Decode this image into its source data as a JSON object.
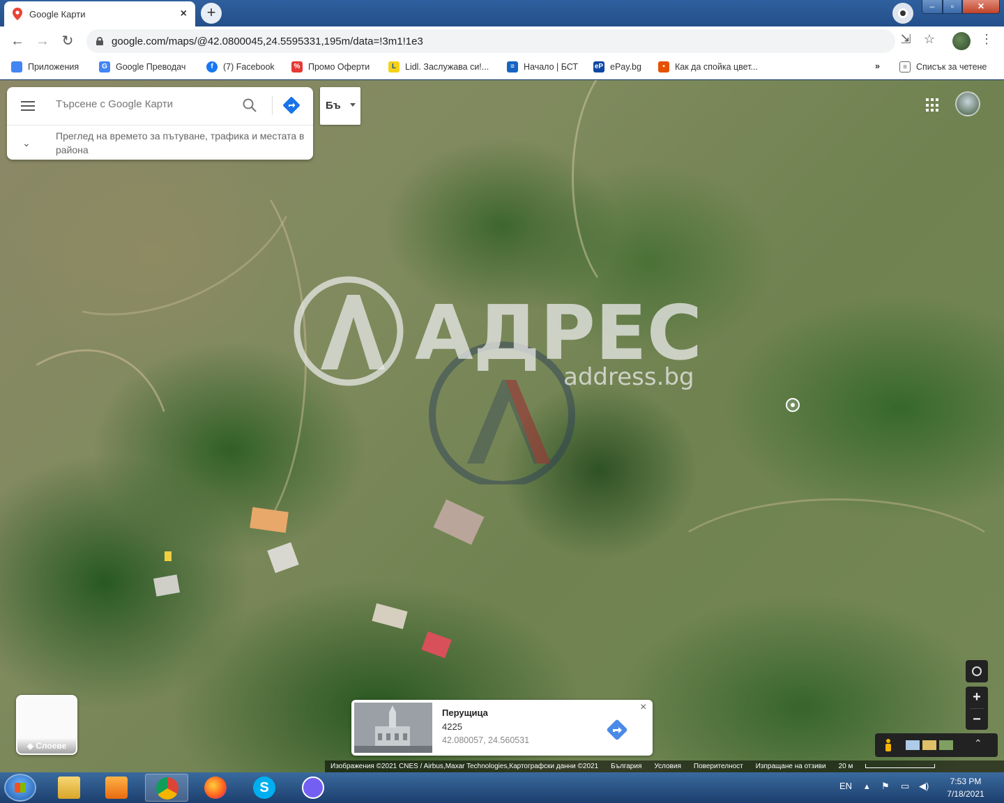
{
  "browser": {
    "tab_title": "Google Карти",
    "url": "google.com/maps/@42.0800045,24.5595331,195m/data=!3m1!1e3",
    "bookmarks": [
      {
        "label": "Приложения",
        "color": "#4285f4"
      },
      {
        "label": "Google Преводач",
        "color": "#4285f4"
      },
      {
        "label": "(7) Facebook",
        "color": "#1877f2"
      },
      {
        "label": "Промо Оферти",
        "color": "#e53935"
      },
      {
        "label": "Lidl. Заслужава си!...",
        "color": "#f7d117"
      },
      {
        "label": "Начало | БСТ",
        "color": "#1565c0"
      },
      {
        "label": "ePay.bg",
        "color": "#0d47a1"
      },
      {
        "label": "Как да спойка цвет...",
        "color": "#e65100"
      }
    ],
    "reading_list": "Списък за четене",
    "more_bookmarks": "»"
  },
  "maps": {
    "search_placeholder": "Търсене с Google Карти",
    "explore_text": "Преглед на времето за пътуване, трафика и местата в района",
    "language_button": "Бъ",
    "layers_label": "Слоеве",
    "place_card": {
      "name": "Перущица",
      "postal_code": "4225",
      "coordinates": "42.080057, 24.560531"
    },
    "attribution": {
      "imagery": "Изображения ©2021 CNES / Airbus,Maxar Technologies,Картографски данни ©2021",
      "country": "България",
      "terms": "Условия",
      "privacy": "Поверителност",
      "feedback": "Изпращане на отзиви",
      "scale": "20 м"
    }
  },
  "watermark": {
    "brand": "АДРЕС",
    "domain": "address.bg"
  },
  "taskbar": {
    "language": "EN",
    "time": "7:53 PM",
    "date": "7/18/2021"
  }
}
